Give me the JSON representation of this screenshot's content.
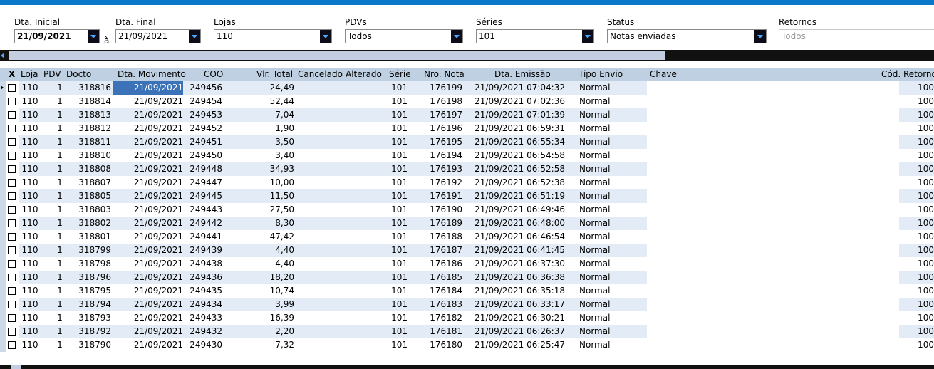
{
  "filters": {
    "dta_inicial": {
      "label": "Dta. Inicial",
      "value": "21/09/2021"
    },
    "separator": "à",
    "dta_final": {
      "label": "Dta. Final",
      "value": "21/09/2021"
    },
    "lojas": {
      "label": "Lojas",
      "value": "110"
    },
    "pdvs": {
      "label": "PDVs",
      "value": "Todos"
    },
    "series": {
      "label": "Séries",
      "value": "101"
    },
    "status": {
      "label": "Status",
      "value": "Notas enviadas"
    },
    "retornos": {
      "label": "Retornos",
      "value": "Todos"
    }
  },
  "grid": {
    "columns": {
      "x": "X",
      "loja": "Loja",
      "pdv": "PDV",
      "docto": "Docto",
      "dta_movimento": "Dta. Movimento",
      "coo": "COO",
      "vlr_total": "Vlr. Total",
      "cancelado": "Cancelado",
      "alterado": "Alterado",
      "serie": "Série",
      "nro_nota": "Nro. Nota",
      "dta_emissao": "Dta. Emissão",
      "tipo_envio": "Tipo Envio",
      "chave": "Chave",
      "cod_retorno": "Cód. Retorno"
    },
    "rows": [
      {
        "loja": "110",
        "pdv": "1",
        "docto": "318816",
        "dta": "21/09/2021",
        "coo": "249456",
        "vlr": "24,49",
        "serie": "101",
        "nota": "176199",
        "emissao": "21/09/2021 07:04:32",
        "tipo": "Normal",
        "ret": "100"
      },
      {
        "loja": "110",
        "pdv": "1",
        "docto": "318814",
        "dta": "21/09/2021",
        "coo": "249454",
        "vlr": "52,44",
        "serie": "101",
        "nota": "176198",
        "emissao": "21/09/2021 07:02:36",
        "tipo": "Normal",
        "ret": "100"
      },
      {
        "loja": "110",
        "pdv": "1",
        "docto": "318813",
        "dta": "21/09/2021",
        "coo": "249453",
        "vlr": "7,04",
        "serie": "101",
        "nota": "176197",
        "emissao": "21/09/2021 07:01:39",
        "tipo": "Normal",
        "ret": "100"
      },
      {
        "loja": "110",
        "pdv": "1",
        "docto": "318812",
        "dta": "21/09/2021",
        "coo": "249452",
        "vlr": "1,90",
        "serie": "101",
        "nota": "176196",
        "emissao": "21/09/2021 06:59:31",
        "tipo": "Normal",
        "ret": "100"
      },
      {
        "loja": "110",
        "pdv": "1",
        "docto": "318811",
        "dta": "21/09/2021",
        "coo": "249451",
        "vlr": "3,50",
        "serie": "101",
        "nota": "176195",
        "emissao": "21/09/2021 06:55:34",
        "tipo": "Normal",
        "ret": "100"
      },
      {
        "loja": "110",
        "pdv": "1",
        "docto": "318810",
        "dta": "21/09/2021",
        "coo": "249450",
        "vlr": "3,40",
        "serie": "101",
        "nota": "176194",
        "emissao": "21/09/2021 06:54:58",
        "tipo": "Normal",
        "ret": "100"
      },
      {
        "loja": "110",
        "pdv": "1",
        "docto": "318808",
        "dta": "21/09/2021",
        "coo": "249448",
        "vlr": "34,93",
        "serie": "101",
        "nota": "176193",
        "emissao": "21/09/2021 06:52:58",
        "tipo": "Normal",
        "ret": "100"
      },
      {
        "loja": "110",
        "pdv": "1",
        "docto": "318807",
        "dta": "21/09/2021",
        "coo": "249447",
        "vlr": "10,00",
        "serie": "101",
        "nota": "176192",
        "emissao": "21/09/2021 06:52:38",
        "tipo": "Normal",
        "ret": "100"
      },
      {
        "loja": "110",
        "pdv": "1",
        "docto": "318805",
        "dta": "21/09/2021",
        "coo": "249445",
        "vlr": "11,50",
        "serie": "101",
        "nota": "176191",
        "emissao": "21/09/2021 06:51:19",
        "tipo": "Normal",
        "ret": "100"
      },
      {
        "loja": "110",
        "pdv": "1",
        "docto": "318803",
        "dta": "21/09/2021",
        "coo": "249443",
        "vlr": "27,50",
        "serie": "101",
        "nota": "176190",
        "emissao": "21/09/2021 06:49:46",
        "tipo": "Normal",
        "ret": "100"
      },
      {
        "loja": "110",
        "pdv": "1",
        "docto": "318802",
        "dta": "21/09/2021",
        "coo": "249442",
        "vlr": "8,30",
        "serie": "101",
        "nota": "176189",
        "emissao": "21/09/2021 06:48:00",
        "tipo": "Normal",
        "ret": "100"
      },
      {
        "loja": "110",
        "pdv": "1",
        "docto": "318801",
        "dta": "21/09/2021",
        "coo": "249441",
        "vlr": "47,42",
        "serie": "101",
        "nota": "176188",
        "emissao": "21/09/2021 06:46:54",
        "tipo": "Normal",
        "ret": "100"
      },
      {
        "loja": "110",
        "pdv": "1",
        "docto": "318799",
        "dta": "21/09/2021",
        "coo": "249439",
        "vlr": "4,40",
        "serie": "101",
        "nota": "176187",
        "emissao": "21/09/2021 06:41:45",
        "tipo": "Normal",
        "ret": "100"
      },
      {
        "loja": "110",
        "pdv": "1",
        "docto": "318798",
        "dta": "21/09/2021",
        "coo": "249438",
        "vlr": "4,40",
        "serie": "101",
        "nota": "176186",
        "emissao": "21/09/2021 06:37:30",
        "tipo": "Normal",
        "ret": "100"
      },
      {
        "loja": "110",
        "pdv": "1",
        "docto": "318796",
        "dta": "21/09/2021",
        "coo": "249436",
        "vlr": "18,20",
        "serie": "101",
        "nota": "176185",
        "emissao": "21/09/2021 06:36:38",
        "tipo": "Normal",
        "ret": "100"
      },
      {
        "loja": "110",
        "pdv": "1",
        "docto": "318795",
        "dta": "21/09/2021",
        "coo": "249435",
        "vlr": "10,74",
        "serie": "101",
        "nota": "176184",
        "emissao": "21/09/2021 06:35:18",
        "tipo": "Normal",
        "ret": "100"
      },
      {
        "loja": "110",
        "pdv": "1",
        "docto": "318794",
        "dta": "21/09/2021",
        "coo": "249434",
        "vlr": "3,99",
        "serie": "101",
        "nota": "176183",
        "emissao": "21/09/2021 06:33:17",
        "tipo": "Normal",
        "ret": "100"
      },
      {
        "loja": "110",
        "pdv": "1",
        "docto": "318793",
        "dta": "21/09/2021",
        "coo": "249433",
        "vlr": "16,39",
        "serie": "101",
        "nota": "176182",
        "emissao": "21/09/2021 06:30:21",
        "tipo": "Normal",
        "ret": "100"
      },
      {
        "loja": "110",
        "pdv": "1",
        "docto": "318792",
        "dta": "21/09/2021",
        "coo": "249432",
        "vlr": "2,20",
        "serie": "101",
        "nota": "176181",
        "emissao": "21/09/2021 06:26:37",
        "tipo": "Normal",
        "ret": "100"
      },
      {
        "loja": "110",
        "pdv": "1",
        "docto": "318790",
        "dta": "21/09/2021",
        "coo": "249430",
        "vlr": "7,32",
        "serie": "101",
        "nota": "176180",
        "emissao": "21/09/2021 06:25:47",
        "tipo": "Normal",
        "ret": "100"
      }
    ]
  }
}
